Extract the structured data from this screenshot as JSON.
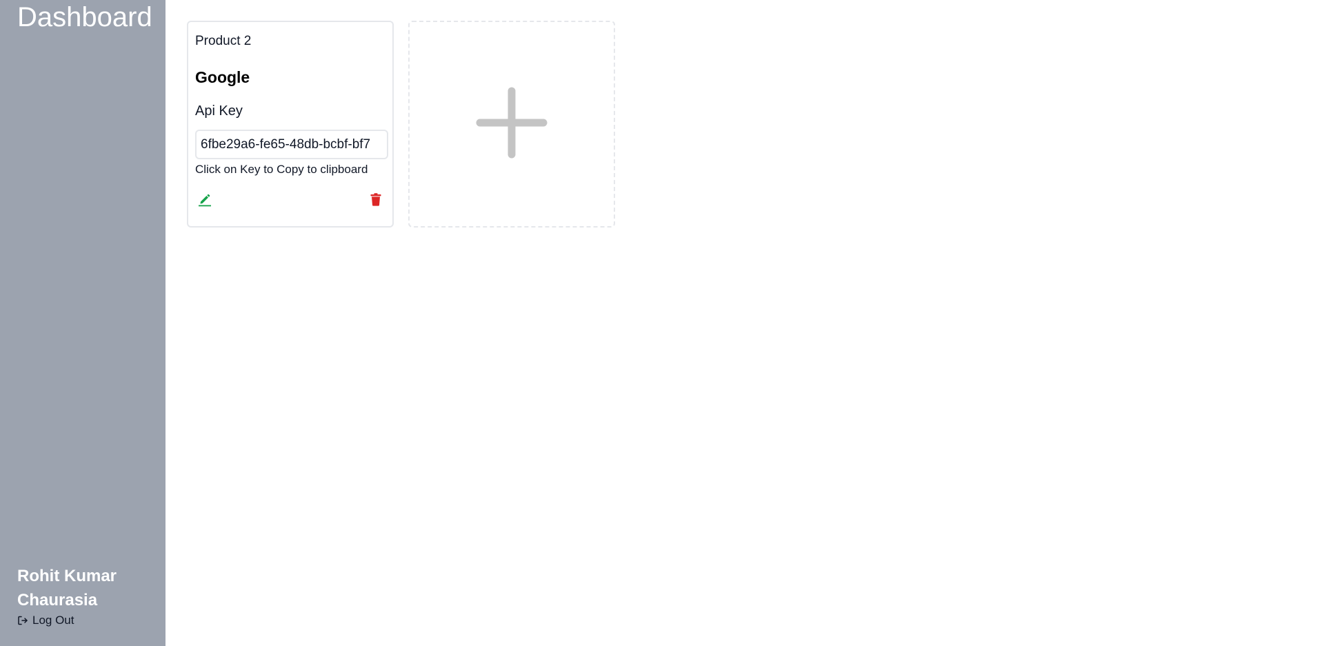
{
  "sidebar": {
    "title": "Dashboard",
    "user": {
      "first_line": "Rohit Kumar",
      "second_line": "Chaurasia"
    },
    "logout_label": "Log Out",
    "background_color": "#9ca3af"
  },
  "cards": [
    {
      "product_name": "Product 2",
      "provider": "Google",
      "api_key_label": "Api Key",
      "api_key_value": "6fbe29a6-fe65-48db-bcbf-bf7",
      "copy_hint": "Click on Key to Copy to clipboard",
      "edit_icon": "pencil-icon",
      "delete_icon": "trash-icon",
      "edit_color": "#16a34a",
      "delete_color": "#dc2626"
    }
  ],
  "add_card": {
    "icon": "plus-icon",
    "icon_color": "#c4c4c4"
  }
}
